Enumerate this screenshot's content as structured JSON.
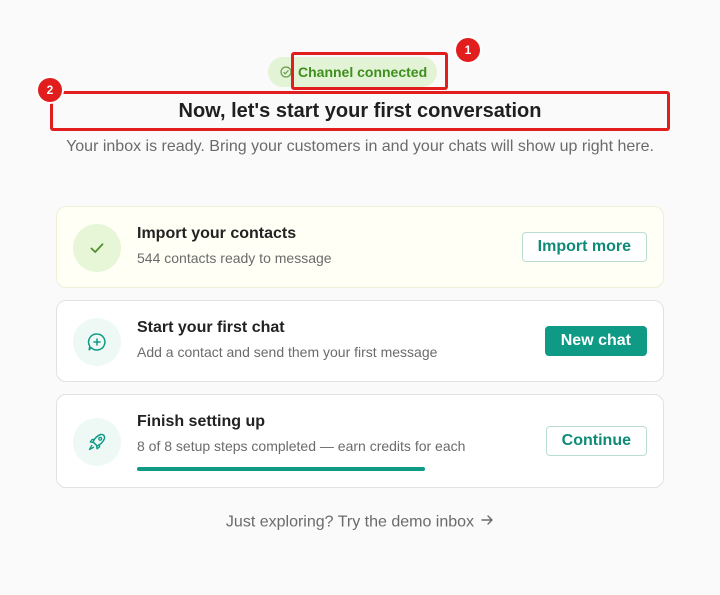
{
  "badge": {
    "label": "Channel connected",
    "icon": "check-circle-icon"
  },
  "callouts": [
    "1",
    "2"
  ],
  "heading": "Now, let's start your first conversation",
  "subtitle": "Your inbox is ready. Bring your customers in and your chats will show up right here.",
  "cards": [
    {
      "title": "Import your contacts",
      "description": "544 contacts ready to message",
      "button": "Import more",
      "icon": "check-icon"
    },
    {
      "title": "Start your first chat",
      "description": "Add a contact and send them your first message",
      "button": "New chat",
      "icon": "chat-plus-icon"
    },
    {
      "title": "Finish setting up",
      "description": "8 of 8 setup steps completed — earn credits for each",
      "button": "Continue",
      "icon": "rocket-icon",
      "progress": 1.0
    }
  ],
  "footer_link": "Just exploring? Try the demo inbox",
  "colors": {
    "accent": "#0f9a86",
    "success": "#3f8f1f",
    "callout": "#e11d1d"
  }
}
